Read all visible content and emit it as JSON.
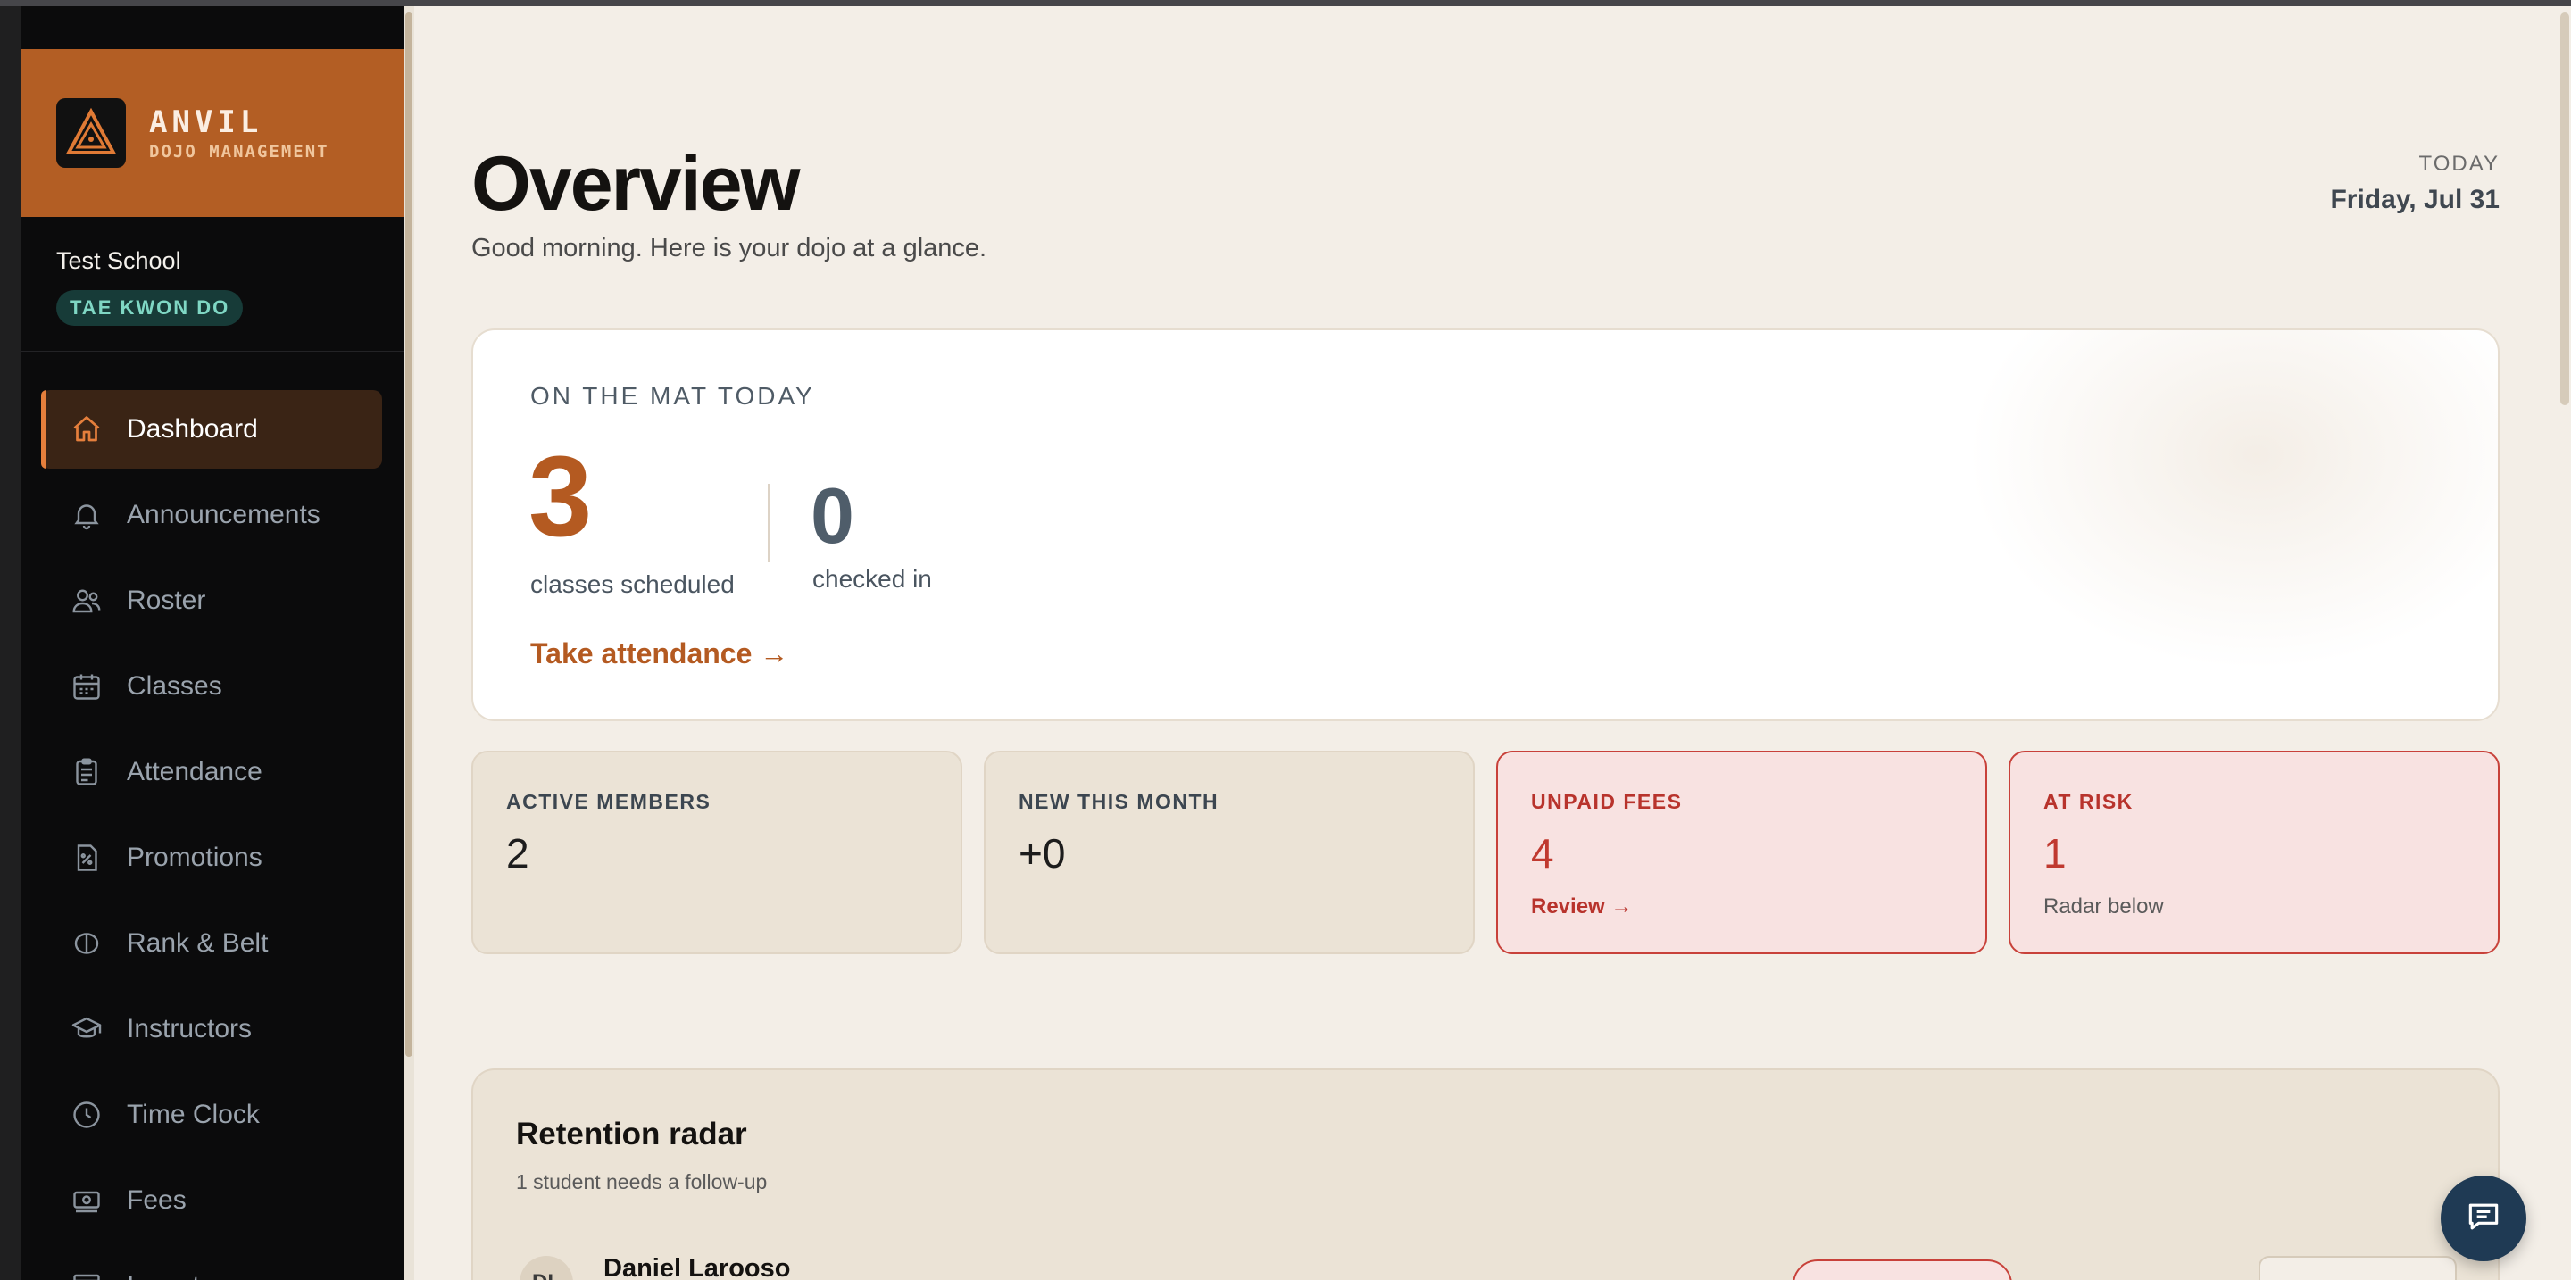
{
  "brand": {
    "name": "ANVIL",
    "subtitle": "DOJO MANAGEMENT",
    "accent": "#b35e24"
  },
  "school": {
    "name": "Test School",
    "discipline": "TAE KWON DO"
  },
  "sidebar": {
    "items": [
      {
        "label": "Dashboard",
        "icon": "home-icon",
        "active": true
      },
      {
        "label": "Announcements",
        "icon": "bell-icon"
      },
      {
        "label": "Roster",
        "icon": "users-icon"
      },
      {
        "label": "Classes",
        "icon": "calendar-icon"
      },
      {
        "label": "Attendance",
        "icon": "clipboard-icon"
      },
      {
        "label": "Promotions",
        "icon": "percent-doc-icon"
      },
      {
        "label": "Rank & Belt",
        "icon": "belt-icon"
      },
      {
        "label": "Instructors",
        "icon": "graduation-cap-icon"
      },
      {
        "label": "Time Clock",
        "icon": "clock-icon"
      },
      {
        "label": "Fees",
        "icon": "money-icon"
      },
      {
        "label": "Inventory",
        "icon": "archive-box-icon"
      }
    ]
  },
  "header": {
    "title": "Overview",
    "subtitle": "Good morning. Here is your dojo at a glance.",
    "today_label": "TODAY",
    "today_date": "Friday, Jul 31"
  },
  "on_the_mat": {
    "label": "ON THE MAT TODAY",
    "classes_scheduled": "3",
    "classes_caption": "classes scheduled",
    "checked_in": "0",
    "checked_in_caption": "checked in",
    "action_label": "Take attendance →"
  },
  "stats": [
    {
      "label": "ACTIVE MEMBERS",
      "value": "2",
      "note": ""
    },
    {
      "label": "NEW THIS MONTH",
      "value": "+0",
      "note": ""
    },
    {
      "label": "UNPAID FEES",
      "value": "4",
      "note": "Review →"
    },
    {
      "label": "AT RISK",
      "value": "1",
      "note": "Radar below"
    }
  ],
  "retention": {
    "title": "Retention radar",
    "subtitle": "1 student needs a follow-up",
    "student_initials": "DL",
    "student_name": "Daniel Larooso"
  },
  "colors": {
    "accent": "#b45a21",
    "alert": "#c0392f",
    "sidebar_bg": "#0b0b0c",
    "page_bg": "#f3eee7"
  }
}
